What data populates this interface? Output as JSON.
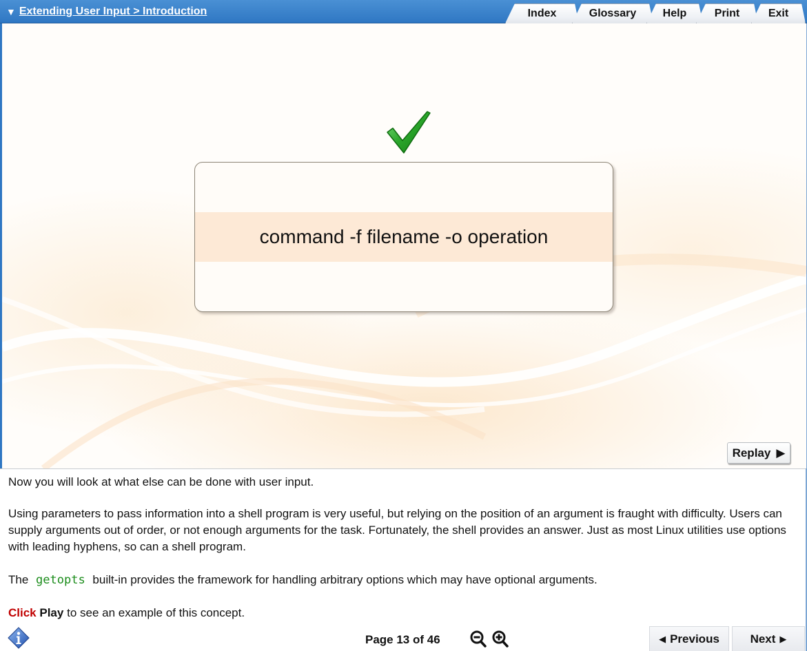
{
  "header": {
    "breadcrumb_arrow": "▼",
    "breadcrumb": "Extending User Input > Introduction",
    "tabs": [
      "Index",
      "Glossary",
      "Help",
      "Print",
      "Exit"
    ]
  },
  "stage": {
    "statement": "command -f filename -o operation",
    "replay_label": "Replay",
    "replay_arrow": "▶"
  },
  "narration": {
    "p1": "Now you will look at what else can be done with user input.",
    "p2": "Using parameters to pass information into a shell program is very useful, but relying on the position of an argument is fraught with difficulty. Users can supply arguments out of order, or not enough arguments for the task. Fortunately, the shell provides an answer. Just as most Linux utilities use options with leading hyphens, so can a shell program.",
    "p3_before": "The",
    "p3_code": "getopts",
    "p3_after": "built-in provides the framework for handling arbitrary options which may have optional arguments.",
    "p4_click": "Click",
    "p4_play": "Play",
    "p4_rest": "to see an example of this concept."
  },
  "footer": {
    "page_indicator": "Page 13 of 46",
    "previous_arrow": "◀",
    "previous_label": "Previous",
    "next_label": "Next",
    "next_arrow": "▶"
  },
  "colors": {
    "header_blue": "#2f77c3",
    "code_green": "#1a8c1a",
    "click_red": "#c00000",
    "band_peach": "#fde9d6",
    "check_green": "#2aa52a"
  },
  "icons": {
    "check": "checkmark-icon",
    "info": "info-icon",
    "zoom_out": "zoom-out-icon",
    "zoom_in": "zoom-in-icon"
  }
}
